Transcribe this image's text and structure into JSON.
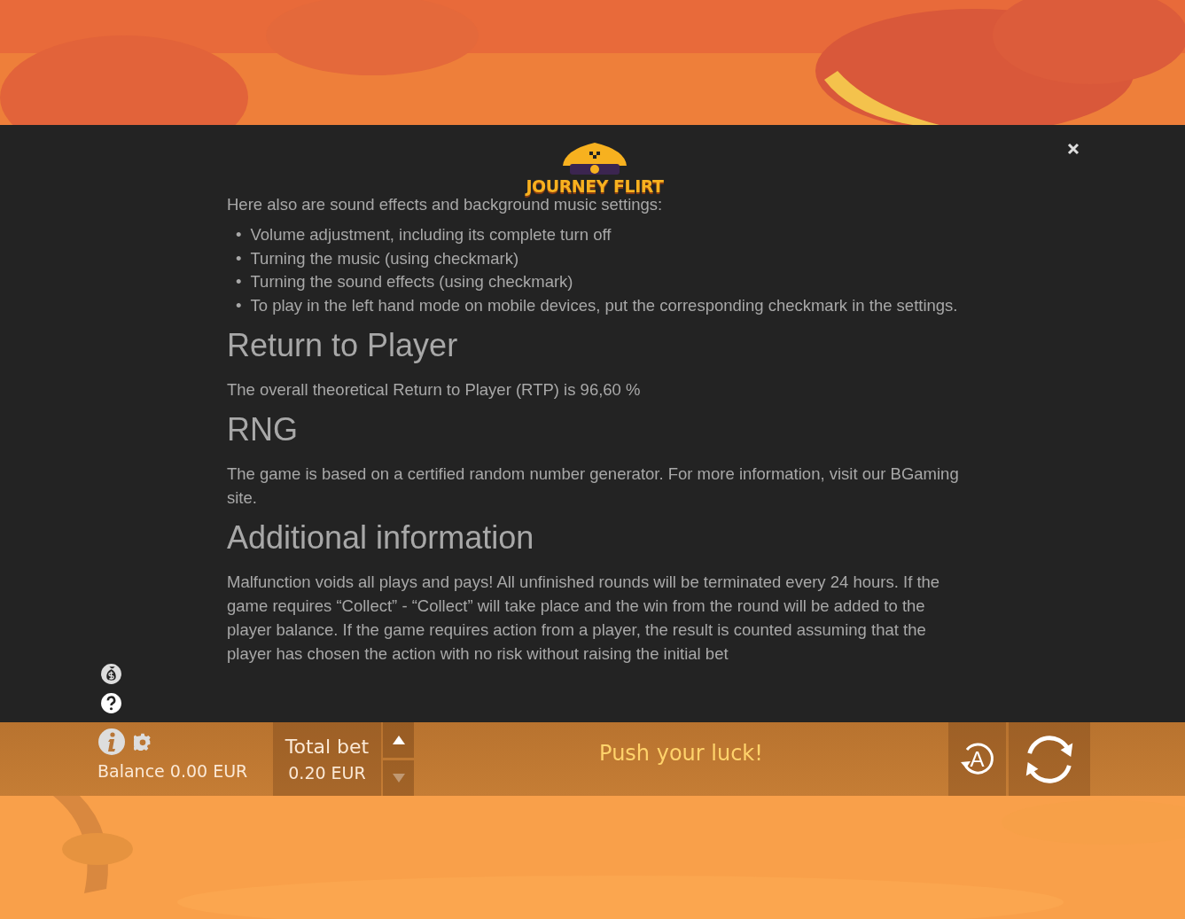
{
  "logo": {
    "text": "JOURNEY FLIRT"
  },
  "rules": {
    "intro": "Here also are sound effects and background music settings:",
    "bullet_marker": "•",
    "bullets": [
      "Volume adjustment, including its complete turn off",
      "Turning the music (using checkmark)",
      "Turning the sound effects (using checkmark)",
      "To play in the left hand mode on mobile devices, put the corresponding checkmark in the settings."
    ],
    "sections": [
      {
        "heading": "Return to Player",
        "text": "The overall theoretical Return to Player (RTP) is 96,60 %"
      },
      {
        "heading": "RNG",
        "text": "The game is based on a certified random number generator. For more information, visit our BGaming site."
      },
      {
        "heading": "Additional information",
        "text": "Malfunction voids all plays and pays! All unfinished rounds will be terminated every 24 hours. If the game requires “Collect” - “Collect” will take place and the win from the round will be added to the player balance. If the game requires action from a player, the result is counted assuming that the player has chosen the action with no risk without raising the initial bet"
      }
    ]
  },
  "bar": {
    "balance": "Balance 0.00 EUR",
    "total_bet_label": "Total bet",
    "total_bet": "0.20 EUR",
    "message": "Push your luck!",
    "autoplay_label": "A",
    "bet_up_disabled": false,
    "bet_down_disabled": true
  }
}
